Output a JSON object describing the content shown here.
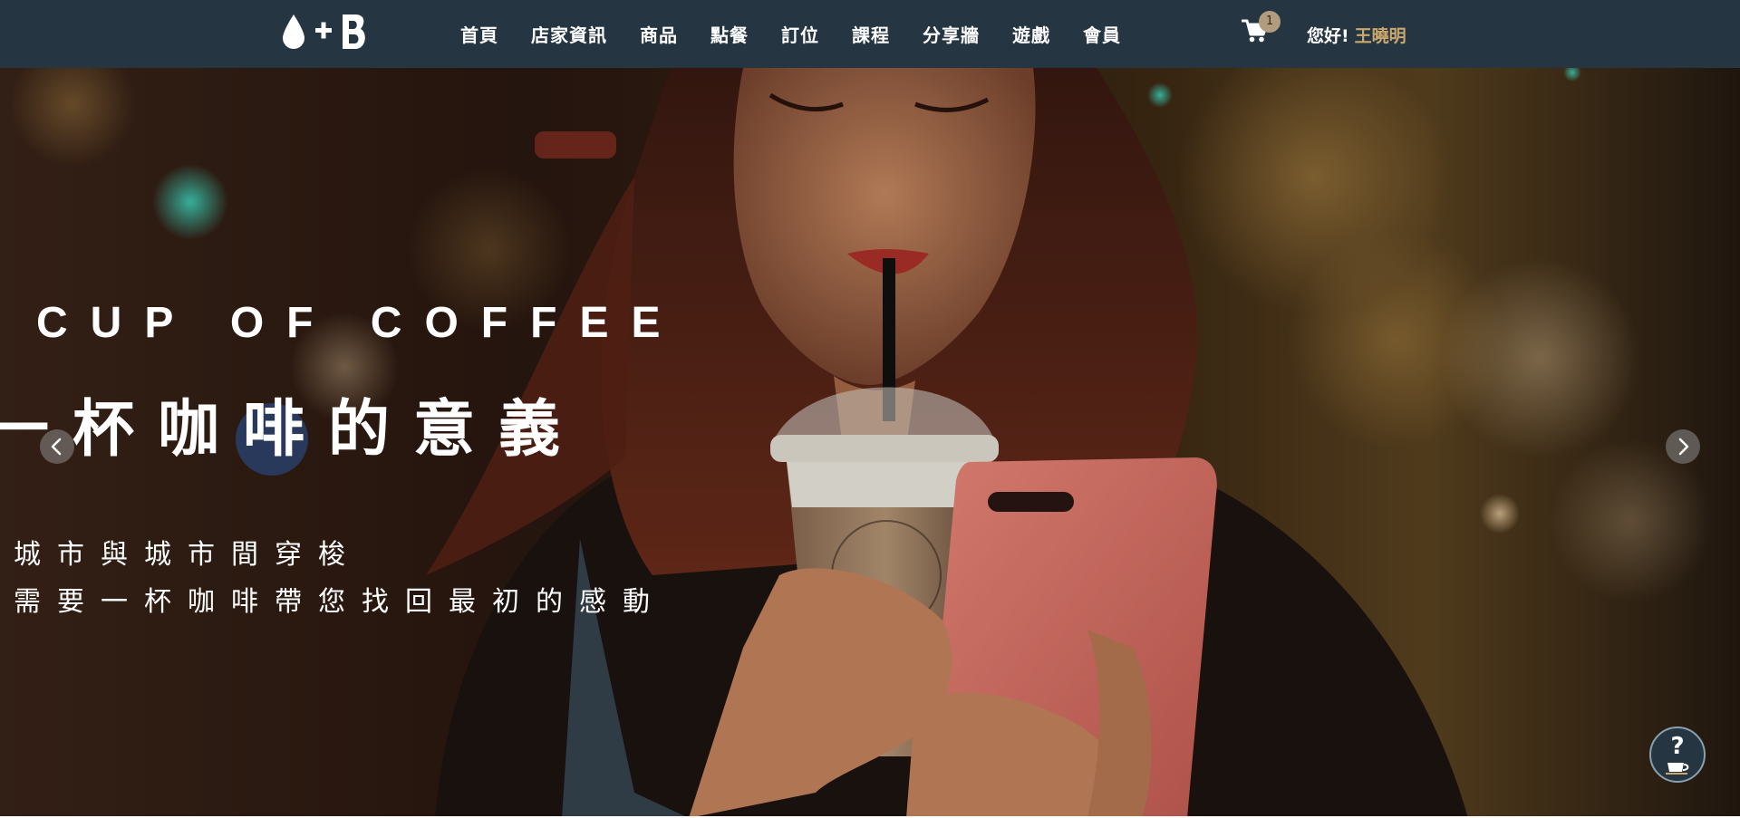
{
  "nav": {
    "logo_icon": "drop-plus-B-logo",
    "items": [
      {
        "label": "首頁"
      },
      {
        "label": "店家資訊"
      },
      {
        "label": "商品"
      },
      {
        "label": "點餐"
      },
      {
        "label": "訂位"
      },
      {
        "label": "課程"
      },
      {
        "label": "分享牆"
      },
      {
        "label": "遊戲"
      },
      {
        "label": "會員"
      }
    ],
    "cart_icon": "shopping-cart-icon",
    "cart_count": "1",
    "greeting": "您好!",
    "user_name": "王曉明"
  },
  "hero": {
    "title_en": "CUP OF COFFEE",
    "title_zh": "一杯咖啡的意義",
    "line1": "城市與城市間穿梭",
    "line2": "需要一杯咖啡帶您找回最初的感動",
    "prev_icon": "chevron-left-icon",
    "next_icon": "chevron-right-icon",
    "help_icon": "question-coffee-icon"
  },
  "colors": {
    "navbar_bg": "#253642",
    "accent_gold": "#c9a76f",
    "badge_bg": "#b29c7e"
  }
}
